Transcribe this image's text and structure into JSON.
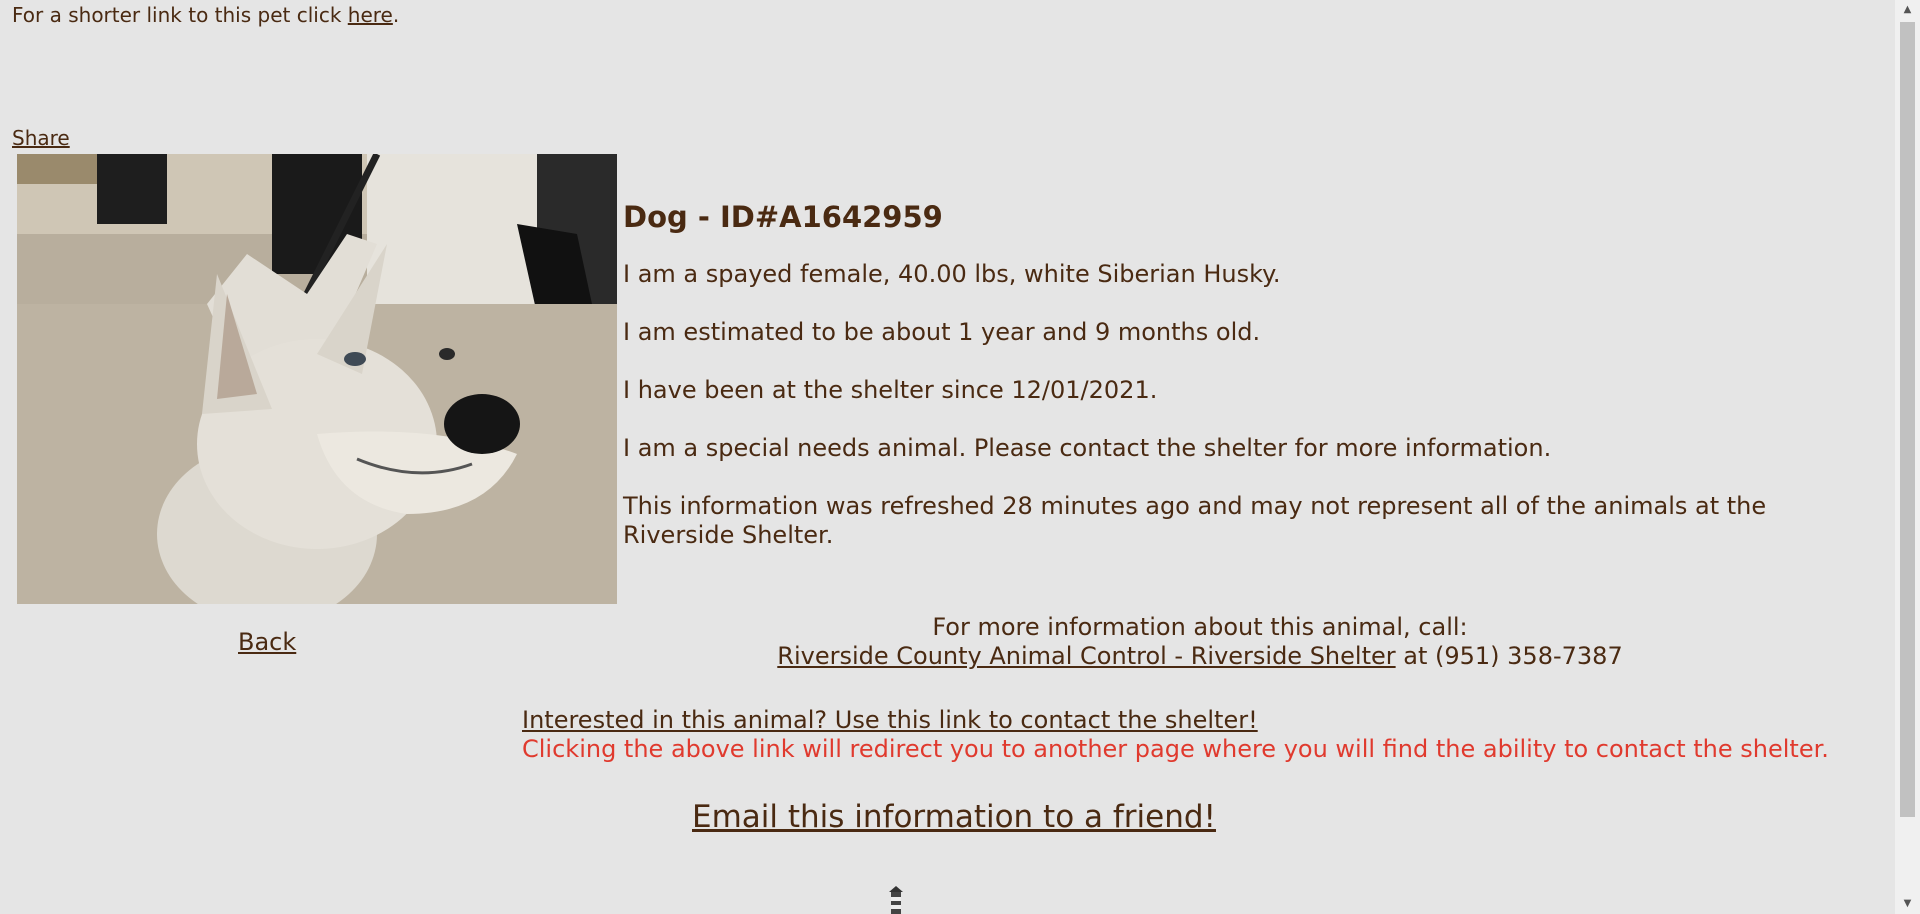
{
  "header": {
    "shortlink_prefix": "For a shorter link to this pet click ",
    "shortlink_link": "here",
    "shortlink_suffix": ".",
    "share": "Share"
  },
  "pet": {
    "title": "Dog - ID#A1642959",
    "line1": "I am a spayed female, 40.00 lbs, white Siberian Husky.",
    "line2": "I am estimated to be about 1 year and 9 months old.",
    "line3": "I have been at the shelter since 12/01/2021.",
    "line4": "I am a special needs animal. Please contact the shelter for more information.",
    "line5": "This information was refreshed 28 minutes ago and may not represent all of the animals at the Riverside Shelter."
  },
  "nav": {
    "back": "Back"
  },
  "contact": {
    "more_info": "For more information about this animal, call:",
    "shelter_name": "Riverside County Animal Control - Riverside Shelter",
    "at_phone": " at (951) 358-7387",
    "interest_link": "Interested in this animal? Use this link to contact the shelter!",
    "redirect_note": "Clicking the above link will redirect you to another page where you will find the ability to contact the shelter.",
    "email_friend": "Email this information to a friend!"
  },
  "colors": {
    "background": "#e5e5e5",
    "text": "#4a2a12",
    "warning": "#e03a2e"
  },
  "icons": {
    "bottom": "lighthouse-icon"
  }
}
